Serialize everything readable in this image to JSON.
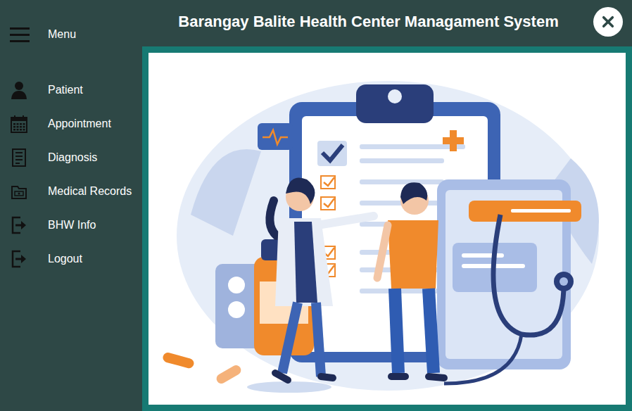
{
  "window": {
    "title": "Barangay Balite Health Center Managament System"
  },
  "sidebar": {
    "menu_label": "Menu",
    "items": [
      {
        "label": "Patient"
      },
      {
        "label": "Appointment"
      },
      {
        "label": "Diagnosis"
      },
      {
        "label": "Medical Records"
      },
      {
        "label": "BHW Info"
      },
      {
        "label": "Logout"
      }
    ]
  }
}
